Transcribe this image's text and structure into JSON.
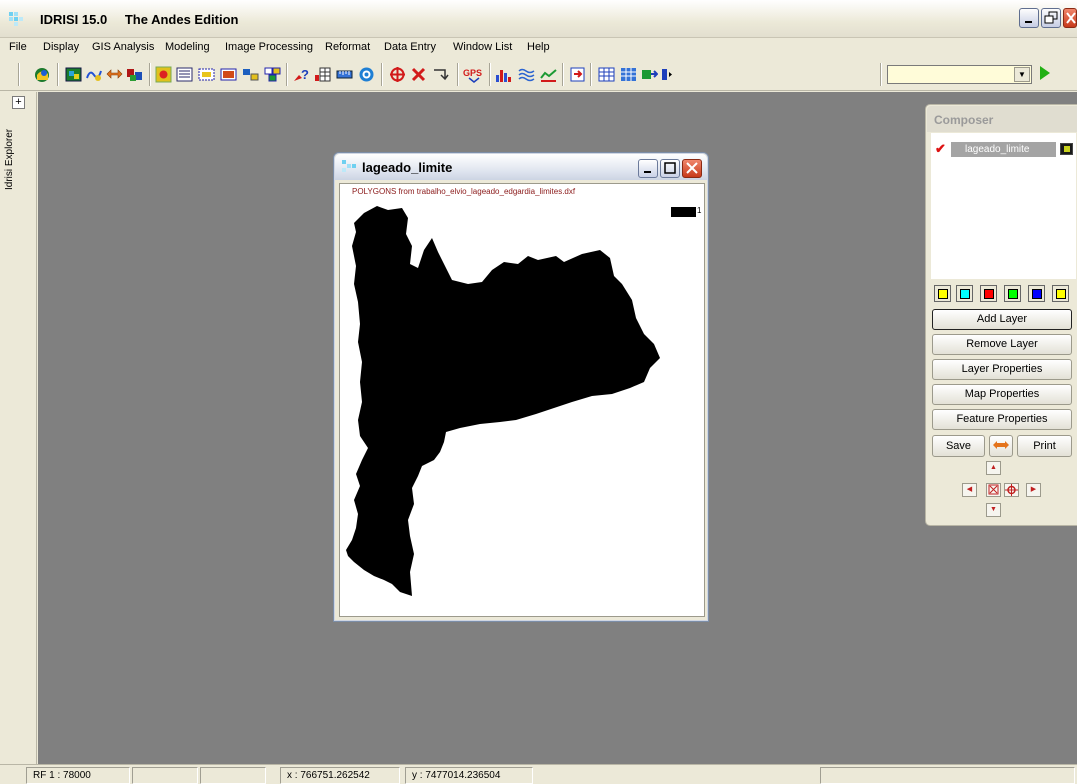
{
  "app": {
    "name": "IDRISI 15.0",
    "edition": "The Andes Edition"
  },
  "menu": [
    "File",
    "Display",
    "GIS Analysis",
    "Modeling",
    "Image Processing",
    "Reformat",
    "Data Entry",
    "Window List",
    "Help"
  ],
  "toolbar": {
    "icons": [
      "display-launcher",
      "composer",
      "add-layer",
      "vector",
      "toggle",
      "layer",
      "symbol",
      "palette",
      "window",
      "box",
      "overlay",
      "layers",
      "query",
      "histogram",
      "measure",
      "target",
      "crosshair",
      "delete",
      "digitize",
      "gps",
      "chart",
      "waves",
      "profile",
      "import",
      "table",
      "grid",
      "database",
      "macro"
    ],
    "combo_value": ""
  },
  "left_panel": {
    "label": "Idrisi Explorer",
    "expand": "+"
  },
  "map_window": {
    "title": "lageado_limite",
    "caption": "POLYGONS from trabalho_elvio_lageado_edgardia_limites.dxf",
    "legend": [
      {
        "label": "1",
        "color": "#000000"
      }
    ]
  },
  "composer": {
    "title": "Composer",
    "layers": [
      {
        "name": "lageado_limite",
        "checked": true
      }
    ],
    "color_buttons": [
      "#ffff00",
      "#00ffff",
      "#ff0000",
      "#00ff00",
      "#0000ff",
      "#ffff00"
    ],
    "buttons": [
      "Add Layer",
      "Remove Layer",
      "Layer Properties",
      "Map Properties",
      "Feature Properties"
    ],
    "save_label": "Save",
    "print_label": "Print"
  },
  "status": {
    "rf": "RF  1 : 78000",
    "x": "x : 766751.262542",
    "y": "y : 7477014.236504"
  }
}
